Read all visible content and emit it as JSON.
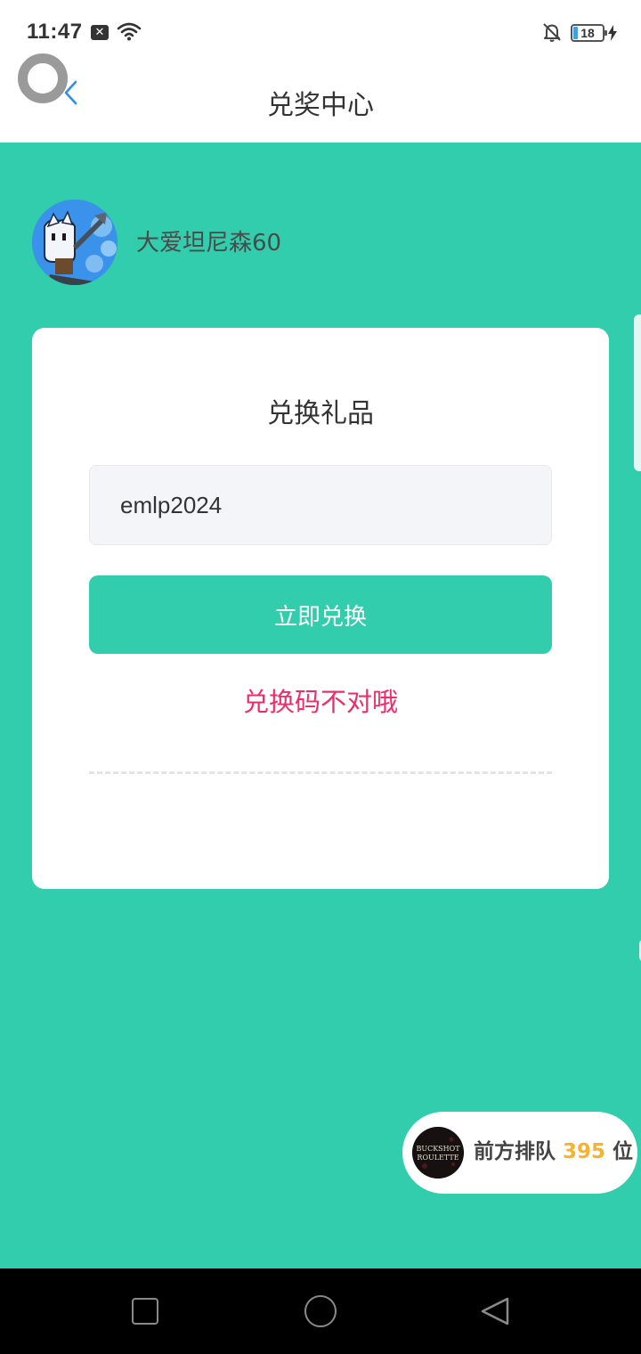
{
  "status_bar": {
    "time": "11:47",
    "notification_badge": "✕",
    "battery_level": "18"
  },
  "header": {
    "title": "兑奖中心"
  },
  "user": {
    "name": "大爱坦尼森60"
  },
  "redeem_card": {
    "title": "兑换礼品",
    "code_value": "emlp2024",
    "button_label": "立即兑换",
    "error_message": "兑换码不对哦"
  },
  "queue": {
    "prefix": "前方排队",
    "count": "395",
    "suffix": "位",
    "game_icon_text_1": "BUCKSHOT",
    "game_icon_text_2": "ROULETTE"
  },
  "colors": {
    "primary": "#31cdac",
    "error": "#ef2d6b",
    "queue_count": "#f6b32b",
    "back_arrow": "#2f8fe8"
  },
  "icons": [
    "wifi-icon",
    "bell-off-icon",
    "charge-icon",
    "back-icon",
    "nav-recent-icon",
    "nav-home-icon",
    "nav-back-icon"
  ]
}
